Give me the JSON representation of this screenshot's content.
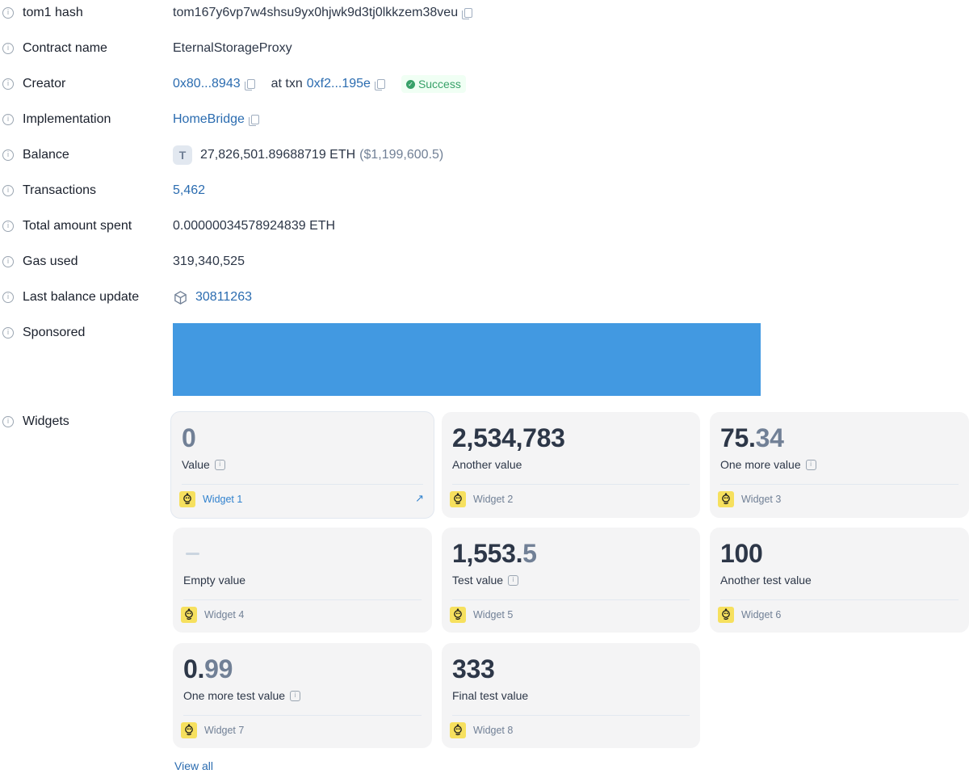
{
  "details": {
    "hash": {
      "label": "tom1 hash",
      "value": "tom167y6vp7w4shsu9yx0hjwk9d3tj0lkkzem38veu"
    },
    "contract_name": {
      "label": "Contract name",
      "value": "EternalStorageProxy"
    },
    "creator": {
      "label": "Creator",
      "address": "0x80...8943",
      "txn_prefix": "at txn",
      "txn": "0xf2...195e",
      "status": "Success"
    },
    "implementation": {
      "label": "Implementation",
      "value": "HomeBridge"
    },
    "balance": {
      "label": "Balance",
      "token_letter": "T",
      "amount": "27,826,501.89688719 ETH",
      "usd": "($1,199,600.5)"
    },
    "transactions": {
      "label": "Transactions",
      "value": "5,462"
    },
    "total_spent": {
      "label": "Total amount spent",
      "value": "0.00000034578924839 ETH"
    },
    "gas_used": {
      "label": "Gas used",
      "value": "319,340,525"
    },
    "last_update": {
      "label": "Last balance update",
      "value": "30811263"
    },
    "sponsored": {
      "label": "Sponsored"
    },
    "widgets_label": {
      "label": "Widgets"
    }
  },
  "widgets": [
    {
      "int": "0",
      "dec": "",
      "label": "Value",
      "info": true,
      "name": "Widget 1",
      "link": true
    },
    {
      "int": "2,534,783",
      "dec": "",
      "label": "Another value",
      "info": false,
      "name": "Widget 2",
      "link": false
    },
    {
      "int": "75.",
      "dec": "34",
      "label": "One more value",
      "info": true,
      "name": "Widget 3",
      "link": false
    },
    {
      "int": "",
      "dec": "",
      "label": "Empty value",
      "info": false,
      "name": "Widget 4",
      "link": false,
      "empty": true
    },
    {
      "int": "1,553.",
      "dec": "5",
      "label": "Test value",
      "info": true,
      "name": "Widget 5",
      "link": false
    },
    {
      "int": "100",
      "dec": "",
      "label": "Another test value",
      "info": false,
      "name": "Widget 6",
      "link": false
    },
    {
      "int": "0.",
      "dec": "99",
      "label": "One more test value",
      "info": true,
      "name": "Widget 7",
      "link": false
    },
    {
      "int": "333",
      "dec": "",
      "label": "Final test value",
      "info": false,
      "name": "Widget 8",
      "link": false
    }
  ],
  "view_all": "View all",
  "colors": {
    "link": "#2b6cb0",
    "success": "#38a169",
    "banner": "#4299e1",
    "widget_bg": "#f4f4f5"
  }
}
